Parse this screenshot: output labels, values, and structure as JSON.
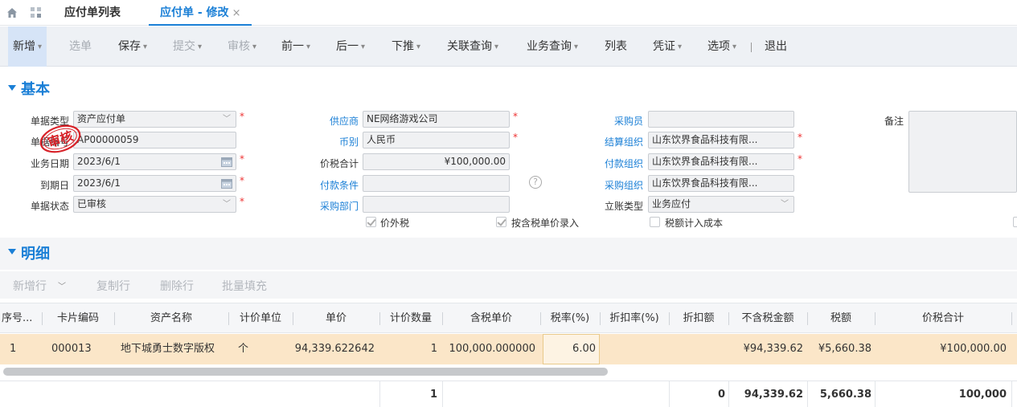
{
  "tabs": {
    "list_label": "应付单列表",
    "active_label": "应付单 - 修改",
    "close_glyph": "×"
  },
  "toolbar": {
    "new": "新增",
    "select": "选单",
    "save": "保存",
    "submit": "提交",
    "audit": "审核",
    "prev": "前一",
    "next": "后一",
    "push": "下推",
    "related_query": "关联查询",
    "business_query": "业务查询",
    "list": "列表",
    "voucher": "凭证",
    "options": "选项",
    "exit": "退出"
  },
  "basic": {
    "section_title": "基本",
    "doc_type_label": "单据类型",
    "doc_type_value": "资产应付单",
    "doc_no_label": "单据编号",
    "doc_no_value": "AP00000059",
    "biz_date_label": "业务日期",
    "biz_date_value": "2023/6/1",
    "due_date_label": "到期日",
    "due_date_value": "2023/6/1",
    "doc_status_label": "单据状态",
    "doc_status_value": "已审核",
    "supplier_label": "供应商",
    "supplier_value": "NE网络游戏公司",
    "currency_label": "币别",
    "currency_value": "人民币",
    "total_label": "价税合计",
    "total_value": "¥100,000.00",
    "payment_terms_label": "付款条件",
    "payment_terms_value": "",
    "purchase_dept_label": "采购部门",
    "purchase_dept_value": "",
    "buyer_label": "采购员",
    "buyer_value": "",
    "settle_org_label": "结算组织",
    "settle_org_value": "山东饮界食品科技有限...",
    "pay_org_label": "付款组织",
    "pay_org_value": "山东饮界食品科技有限...",
    "purchase_org_label": "采购组织",
    "purchase_org_value": "山东饮界食品科技有限...",
    "account_type_label": "立账类型",
    "account_type_value": "业务应付",
    "remark_label": "备注",
    "price_excl_tax_label": "价外税",
    "tax_incl_price_entry_label": "按含税单价录入",
    "tax_in_cost_label": "税额计入成本",
    "stamp_text": "审核",
    "required_mark": "*",
    "help_glyph": "?"
  },
  "detail": {
    "section_title": "明细",
    "add_row": "新增行",
    "copy_row": "复制行",
    "delete_row": "删除行",
    "batch_fill": "批量填充",
    "columns": [
      "序号...",
      "卡片编码",
      "资产名称",
      "计价单位",
      "单价",
      "计价数量",
      "含税单价",
      "税率(%)",
      "折扣率(%)",
      "折扣额",
      "不含税金额",
      "税额",
      "价税合计"
    ],
    "rows": [
      [
        "1",
        "000013",
        "地下城勇士数字版权",
        "个",
        "94,339.622642",
        "1",
        "100,000.000000",
        "6.00",
        "",
        "",
        "¥94,339.62",
        "¥5,660.38",
        "¥100,000.00"
      ]
    ],
    "totals": {
      "qty": "1",
      "discount": "0",
      "amount_excl_tax": "94,339.62",
      "tax": "5,660.38",
      "total": "100,000"
    }
  }
}
